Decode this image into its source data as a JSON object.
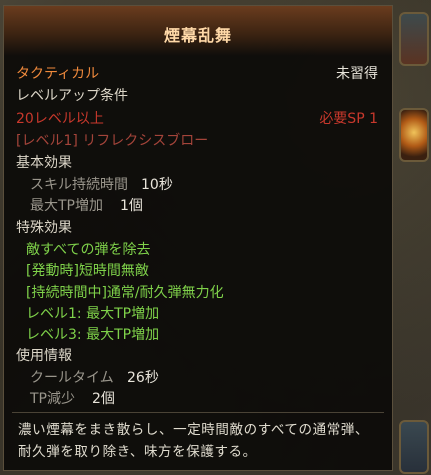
{
  "tooltip": {
    "title": "煙幕乱舞",
    "category": "タクティカル",
    "status": "未習得",
    "level_condition_heading": "レベルアップ条件",
    "level_req": "20レベル以上",
    "sp_req": "必要SP 1",
    "prereq_skill": "[レベル1] リフレクシスブロー",
    "basic_heading": "基本効果",
    "basic": [
      {
        "label": "スキル持続時間",
        "value": "10秒"
      },
      {
        "label": "最大TP増加",
        "value": "1個"
      }
    ],
    "special_heading": "特殊効果",
    "special": [
      "敵すべての弾を除去",
      "[発動時]短時間無敵",
      "[持続時間中]通常/耐久弾無力化",
      "レベル1: 最大TP増加",
      "レベル3: 最大TP増加"
    ],
    "usage_heading": "使用情報",
    "usage": [
      {
        "label": "クールタイム",
        "value": "26秒"
      },
      {
        "label": "TP減少",
        "value": "2個"
      }
    ],
    "description": "濃い煙幕をまき散らし、一定時間敵のすべての通常弾、耐久弾を取り除き、味方を保護する。"
  },
  "colors": {
    "category": "#f08a3c",
    "requirement": "#c8382c",
    "effect": "#7fd24a",
    "title": "#ffd9a8"
  }
}
